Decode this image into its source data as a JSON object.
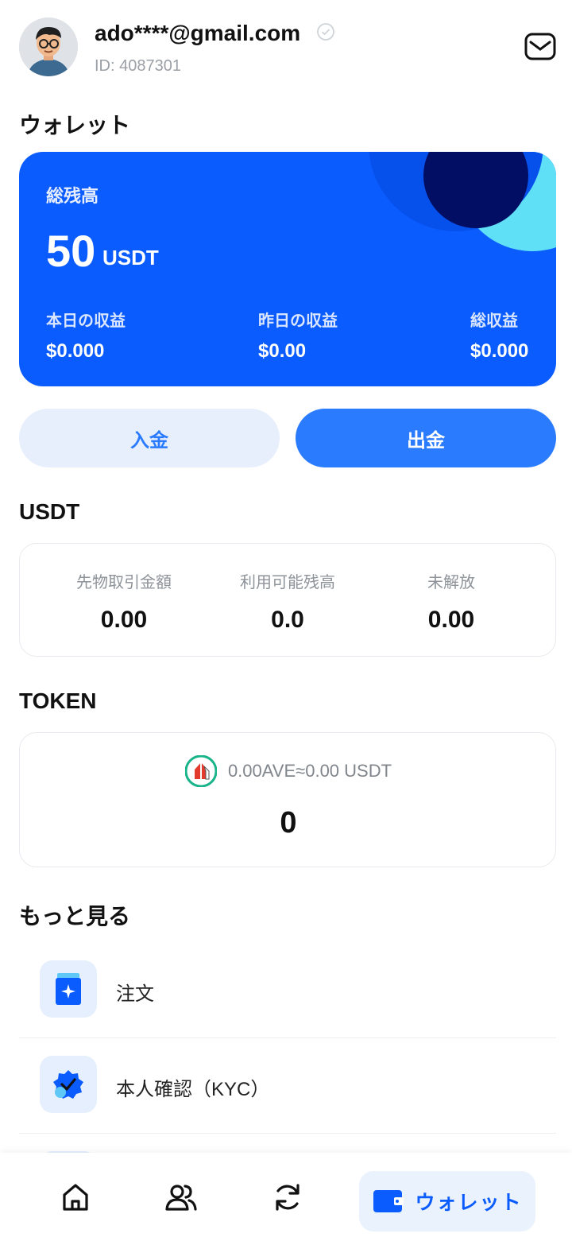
{
  "user": {
    "email": "ado****@gmail.com",
    "id_label": "ID: 4087301"
  },
  "wallet": {
    "section_title": "ウォレット",
    "total_label": "総残高",
    "total_amount": "50",
    "total_unit": "USDT",
    "stats": [
      {
        "label": "本日の収益",
        "value": "$0.000"
      },
      {
        "label": "昨日の収益",
        "value": "$0.00"
      },
      {
        "label": "総収益",
        "value": "$0.000"
      }
    ],
    "deposit_label": "入金",
    "withdraw_label": "出金"
  },
  "usdt": {
    "section_title": "USDT",
    "columns": [
      {
        "label": "先物取引金額",
        "value": "0.00"
      },
      {
        "label": "利用可能残高",
        "value": "0.0"
      },
      {
        "label": "未解放",
        "value": "0.00"
      }
    ]
  },
  "token": {
    "section_title": "TOKEN",
    "conversion_text": "0.00AVE≈0.00 USDT",
    "value": "0"
  },
  "more": {
    "section_title": "もっと見る",
    "items": [
      {
        "label": "注文",
        "icon": "orders-icon"
      },
      {
        "label": "本人確認（KYC）",
        "icon": "kyc-badge-icon"
      }
    ]
  },
  "tabbar": {
    "active_label": "ウォレット",
    "tabs": [
      "home-icon",
      "users-icon",
      "refresh-icon",
      "wallet-icon"
    ]
  },
  "colors": {
    "primary": "#0b5cff",
    "accent": "#2b7bff",
    "light_accent": "#e7effd"
  }
}
